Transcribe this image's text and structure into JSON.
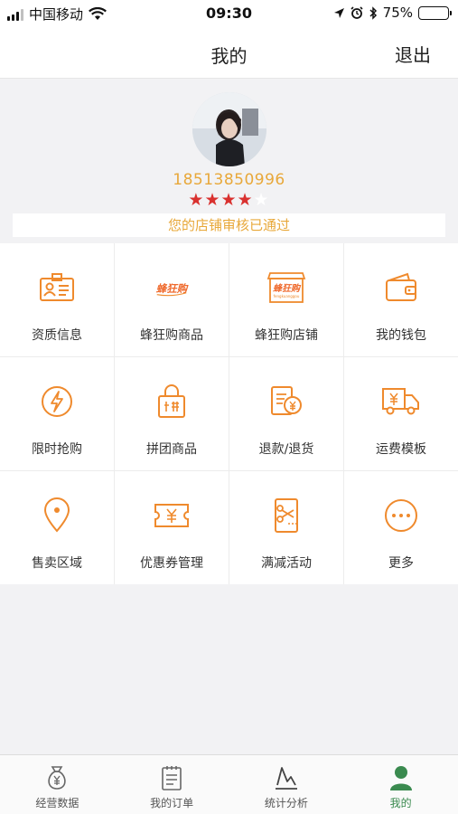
{
  "status": {
    "carrier": "中国移动",
    "time": "09:30",
    "battery": "75%"
  },
  "nav": {
    "title": "我的",
    "logout": "退出"
  },
  "profile": {
    "phone": "18513850996",
    "stars_on": "★★★★",
    "stars_off": "★",
    "approval": "您的店铺审核已通过"
  },
  "grid": [
    {
      "label": "资质信息",
      "icon": "id-card-icon"
    },
    {
      "label": "蜂狂购商品",
      "icon": "brand-logo-icon"
    },
    {
      "label": "蜂狂购店铺",
      "icon": "store-logo-icon"
    },
    {
      "label": "我的钱包",
      "icon": "wallet-icon"
    },
    {
      "label": "限时抢购",
      "icon": "flash-sale-icon"
    },
    {
      "label": "拼团商品",
      "icon": "group-buy-bag-icon"
    },
    {
      "label": "退款/退货",
      "icon": "refund-icon"
    },
    {
      "label": "运费模板",
      "icon": "delivery-truck-icon"
    },
    {
      "label": "售卖区域",
      "icon": "location-pin-icon"
    },
    {
      "label": "优惠券管理",
      "icon": "coupon-icon"
    },
    {
      "label": "满减活动",
      "icon": "discount-scissors-icon"
    },
    {
      "label": "更多",
      "icon": "more-dots-icon"
    }
  ],
  "brand": {
    "logo_text": "蜂狂购",
    "logo_sub": "fengkuanggou"
  },
  "tabs": [
    {
      "label": "经营数据",
      "icon": "money-bag-icon"
    },
    {
      "label": "我的订单",
      "icon": "order-list-icon"
    },
    {
      "label": "统计分析",
      "icon": "chart-icon"
    },
    {
      "label": "我的",
      "icon": "user-icon",
      "active": true
    }
  ],
  "colors": {
    "accent": "#e8a83a",
    "icon_orange": "#ef8a2d",
    "star": "#d9312f",
    "tab_active": "#3a8a4f"
  }
}
